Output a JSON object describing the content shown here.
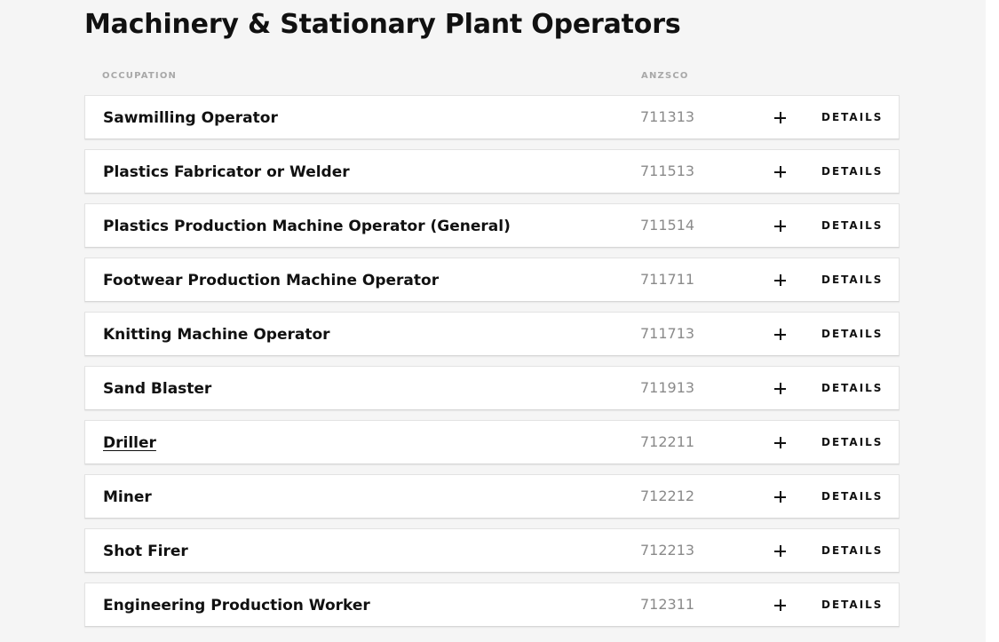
{
  "page": {
    "heading": "Machinery & Stationary Plant Operators"
  },
  "table": {
    "columns": {
      "occupation": "OCCUPATION",
      "anzsco": "ANZSCO"
    },
    "rows": [
      {
        "name": "Sawmilling Operator",
        "code": "711313",
        "action": "DETAILS",
        "underlined": false
      },
      {
        "name": "Plastics Fabricator or Welder",
        "code": "711513",
        "action": "DETAILS",
        "underlined": false
      },
      {
        "name": "Plastics Production Machine Operator (General)",
        "code": "711514",
        "action": "DETAILS",
        "underlined": false
      },
      {
        "name": "Footwear Production Machine Operator",
        "code": "711711",
        "action": "DETAILS",
        "underlined": false
      },
      {
        "name": "Knitting Machine Operator",
        "code": "711713",
        "action": "DETAILS",
        "underlined": false
      },
      {
        "name": "Sand Blaster",
        "code": "711913",
        "action": "DETAILS",
        "underlined": false
      },
      {
        "name": "Driller",
        "code": "712211",
        "action": "DETAILS",
        "underlined": true
      },
      {
        "name": "Miner",
        "code": "712212",
        "action": "DETAILS",
        "underlined": false
      },
      {
        "name": "Shot Firer",
        "code": "712213",
        "action": "DETAILS",
        "underlined": false
      },
      {
        "name": "Engineering Production Worker",
        "code": "712311",
        "action": "DETAILS",
        "underlined": false
      }
    ]
  },
  "icons": {
    "expand": "plus-icon"
  },
  "colors": {
    "background": "#f5f5f5",
    "row_background": "#ffffff",
    "text": "#111111",
    "code_text": "#8a8a8a",
    "header_text": "#a8a8a8"
  }
}
